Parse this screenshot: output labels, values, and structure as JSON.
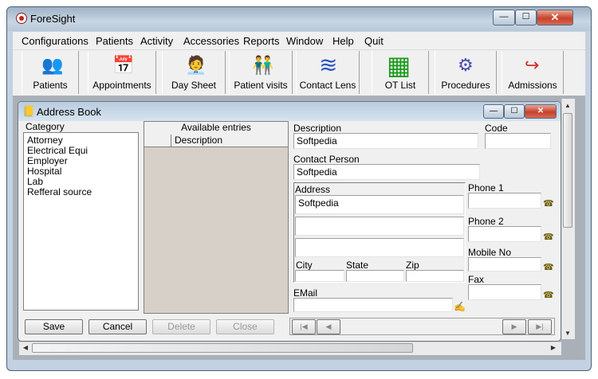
{
  "window": {
    "title": "ForeSight",
    "min": "—",
    "max": "☐",
    "close": "✕"
  },
  "menu": [
    "Configurations",
    "Patients",
    "Activity",
    "Accessories",
    "Reports",
    "Window",
    "Help",
    "Quit"
  ],
  "toolbar": [
    {
      "label": "Patients",
      "icon": "patients-icon",
      "glyph": "👥"
    },
    {
      "label": "Appointments",
      "icon": "calendar-icon",
      "glyph": "📅"
    },
    {
      "label": "Day Sheet",
      "icon": "day-sheet-icon",
      "glyph": "🧑‍💼"
    },
    {
      "label": "Patient visits",
      "icon": "patient-visits-icon",
      "glyph": "👬"
    },
    {
      "label": "Contact Lens",
      "icon": "contact-lens-icon",
      "glyph": "≋"
    },
    {
      "label": "OT List",
      "icon": "ot-list-icon",
      "glyph": "▦"
    },
    {
      "label": "Procedures",
      "icon": "procedures-icon",
      "glyph": "⚙"
    },
    {
      "label": "Admissions",
      "icon": "admissions-icon",
      "glyph": "↪"
    }
  ],
  "address_book": {
    "title": "Address Book",
    "category_label": "Category",
    "categories": [
      "Attorney",
      "Electrical Equi",
      "Employer",
      "Hospital",
      "Lab",
      "Refferal source"
    ],
    "available_entries_label": "Available entries",
    "description_col": "Description",
    "description_label": "Description",
    "description_value": "Softpedia",
    "code_label": "Code",
    "code_value": "",
    "contact_person_label": "Contact Person",
    "contact_person_value": "Softpedia",
    "address_label": "Address",
    "address_line1": "Softpedia",
    "address_line2": "",
    "address_line3": "",
    "city_label": "City",
    "state_label": "State",
    "zip_label": "Zip",
    "email_label": "EMail",
    "phone1_label": "Phone 1",
    "phone2_label": "Phone 2",
    "mobile_label": "Mobile No",
    "fax_label": "Fax",
    "buttons": {
      "save": "Save",
      "cancel": "Cancel",
      "delete": "Delete",
      "close": "Close"
    },
    "nav": {
      "first": "|◀",
      "prev": "◀",
      "next": "▶",
      "last": "▶|"
    }
  },
  "colors": {
    "accent": "#c8412a",
    "titlebar": "#b9cbe0"
  }
}
